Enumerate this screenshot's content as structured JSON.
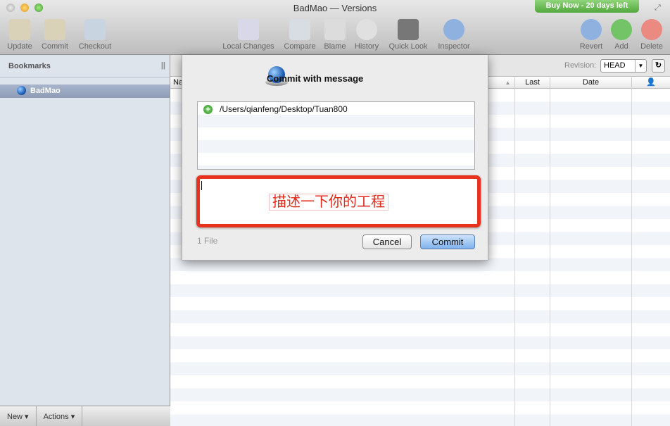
{
  "window": {
    "title": "BadMao — Versions",
    "buy_now": "Buy Now - 20 days left"
  },
  "toolbar": {
    "left": [
      {
        "label": "Update",
        "icon": "update-icon"
      },
      {
        "label": "Commit",
        "icon": "commit-icon"
      },
      {
        "label": "Checkout",
        "icon": "checkout-icon"
      }
    ],
    "center": [
      {
        "label": "Local Changes",
        "icon": "local-changes-icon"
      },
      {
        "label": "Compare",
        "icon": "compare-icon"
      },
      {
        "label": "Blame",
        "icon": "blame-icon"
      },
      {
        "label": "History",
        "icon": "history-icon"
      },
      {
        "label": "Quick Look",
        "icon": "quick-look-icon"
      },
      {
        "label": "Inspector",
        "icon": "inspector-icon"
      }
    ],
    "right": [
      {
        "label": "Revert",
        "icon": "revert-icon"
      },
      {
        "label": "Add",
        "icon": "add-icon"
      },
      {
        "label": "Delete",
        "icon": "delete-icon"
      }
    ]
  },
  "sidebar": {
    "header": "Bookmarks",
    "items": [
      {
        "label": "BadMao"
      }
    ],
    "bottom": {
      "new": "New ▾",
      "actions": "Actions ▾"
    }
  },
  "main": {
    "revision_label": "Revision:",
    "revision_value": "HEAD",
    "columns": [
      "Na",
      "Last",
      "Date"
    ]
  },
  "dialog": {
    "title": "Commit with message",
    "files": [
      "/Users/qianfeng/Desktop/Tuan800"
    ],
    "message": "描述一下你的工程",
    "file_count": "1 File",
    "cancel": "Cancel",
    "commit": "Commit"
  },
  "colors": {
    "accent_red": "#e8321e",
    "buy_green": "#52a83c",
    "selection": "#8e9cb7"
  }
}
